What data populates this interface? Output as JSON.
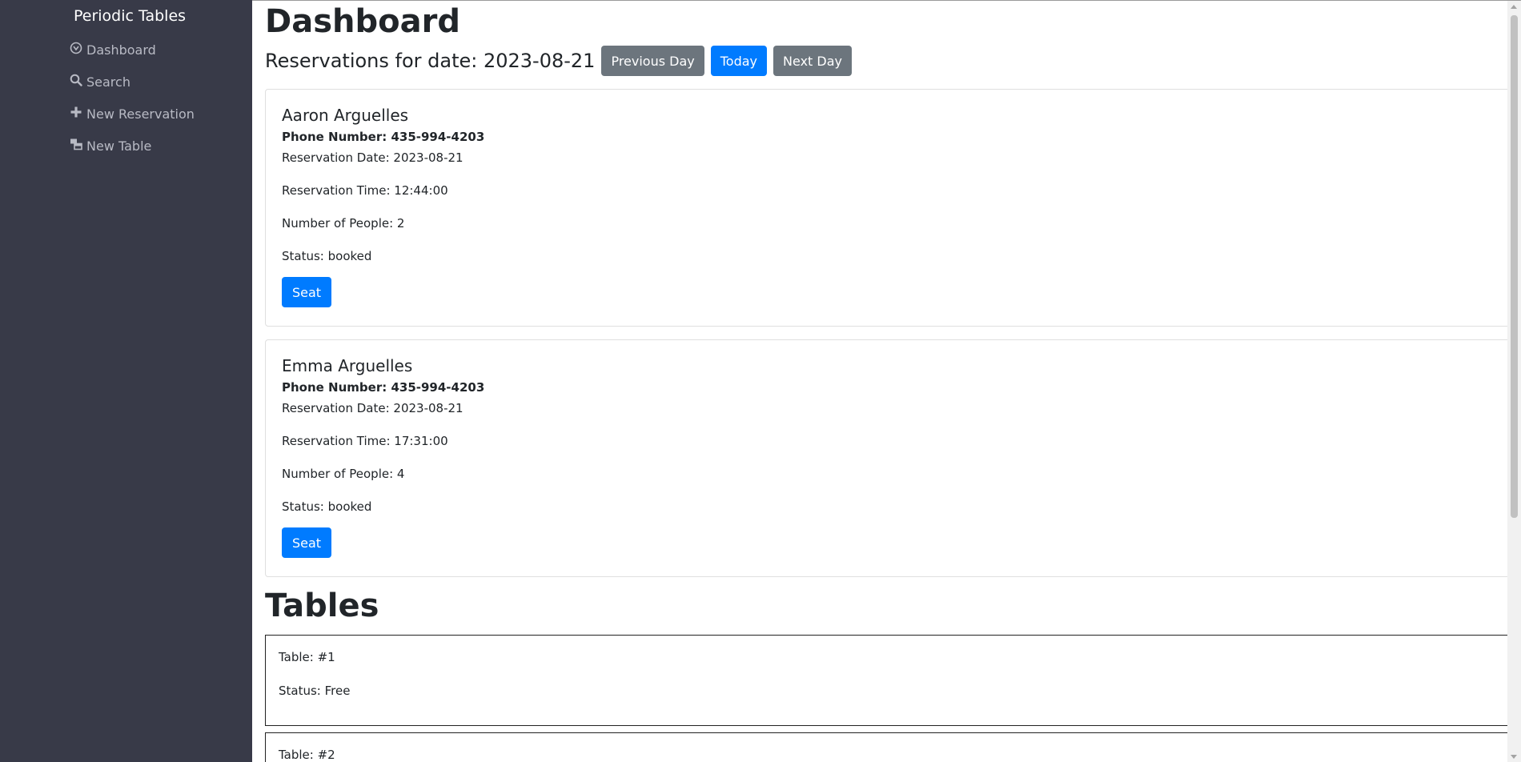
{
  "sidebar": {
    "brand": "Periodic Tables",
    "items": [
      {
        "label": "Dashboard",
        "icon": "dashboard-icon"
      },
      {
        "label": "Search",
        "icon": "search-icon"
      },
      {
        "label": "New Reservation",
        "icon": "plus-icon"
      },
      {
        "label": "New Table",
        "icon": "table-icon"
      }
    ]
  },
  "main": {
    "title": "Dashboard",
    "date_label": "Reservations for date: 2023-08-21",
    "buttons": {
      "previous": "Previous Day",
      "today": "Today",
      "next": "Next Day"
    },
    "reservations": [
      {
        "name": "Aaron Arguelles",
        "phone": "Phone Number: 435-994-4203",
        "date": "Reservation Date: 2023-08-21",
        "time": "Reservation Time: 12:44:00",
        "people": "Number of People: 2",
        "status": "Status: booked",
        "seat_label": "Seat"
      },
      {
        "name": "Emma Arguelles",
        "phone": "Phone Number: 435-994-4203",
        "date": "Reservation Date: 2023-08-21",
        "time": "Reservation Time: 17:31:00",
        "people": "Number of People: 4",
        "status": "Status: booked",
        "seat_label": "Seat"
      }
    ],
    "tables_title": "Tables",
    "tables": [
      {
        "table": "Table: #1",
        "status": "Status: Free"
      },
      {
        "table": "Table: #2",
        "status": ""
      }
    ]
  },
  "colors": {
    "sidebar_bg": "#383a48",
    "primary": "#007bff",
    "secondary": "#6c757d"
  }
}
